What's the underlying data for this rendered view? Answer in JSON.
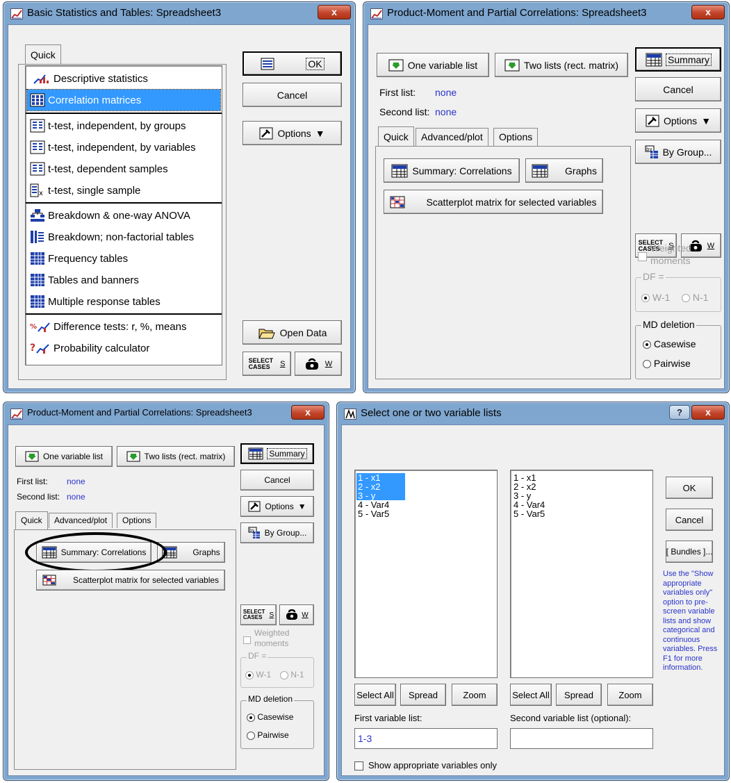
{
  "win1": {
    "title": "Basic Statistics and Tables: Spreadsheet3",
    "close": "x",
    "tab": "Quick",
    "items": [
      {
        "label": "Descriptive statistics",
        "icon": "descriptive-icon"
      },
      {
        "label": "Correlation matrices",
        "icon": "matrix-icon"
      },
      {
        "label": "t-test, independent, by groups",
        "icon": "ttest-icon"
      },
      {
        "label": "t-test, independent, by variables",
        "icon": "ttest-icon"
      },
      {
        "label": "t-test, dependent samples",
        "icon": "ttest-icon"
      },
      {
        "label": "t-test, single sample",
        "icon": "ttest-single-icon"
      },
      {
        "label": "Breakdown & one-way ANOVA",
        "icon": "breakdown-icon"
      },
      {
        "label": "Breakdown; non-factorial tables",
        "icon": "breakdown-tables-icon"
      },
      {
        "label": "Frequency tables",
        "icon": "table-icon"
      },
      {
        "label": "Tables and banners",
        "icon": "table-icon"
      },
      {
        "label": "Multiple response tables",
        "icon": "table-icon"
      },
      {
        "label": "Difference tests: r, %, means",
        "icon": "difference-icon"
      },
      {
        "label": "Probability calculator",
        "icon": "probability-icon"
      }
    ],
    "selected_item": "Correlation matrices",
    "ok": "OK",
    "cancel": "Cancel",
    "options": "Options",
    "open_data": "Open Data",
    "select_cases_1": "SELECT",
    "select_cases_2": "CASES",
    "s": "S",
    "w": "W"
  },
  "win2": {
    "title": "Product-Moment and Partial Correlations: Spreadsheet3",
    "close": "x",
    "one_var": "One variable list",
    "two_lists": "Two lists (rect. matrix)",
    "summary": "Summary",
    "cancel": "Cancel",
    "options": "Options",
    "by_group": "By Group...",
    "first_list_label": "First list:",
    "first_list_value": "none",
    "second_list_label": "Second list:",
    "second_list_value": "none",
    "tabs": [
      "Quick",
      "Advanced/plot",
      "Options"
    ],
    "summary_corr": "Summary: Correlations",
    "graphs": "Graphs",
    "scatterplot": "Scatterplot matrix for selected variables",
    "select_cases_1": "SELECT",
    "select_cases_2": "CASES",
    "s": "S",
    "w": "W",
    "weighted": "Weighted",
    "moments": "moments",
    "df": "DF =",
    "w1": "W-1",
    "n1": "N-1",
    "md_deletion": "MD deletion",
    "casewise": "Casewise",
    "pairwise": "Pairwise"
  },
  "win4": {
    "title": "Select one or two variable lists",
    "help": "?",
    "close": "x",
    "vars": [
      "1 - x1",
      "2 - x2",
      "3 - y",
      "4 - Var4",
      "5 - Var5"
    ],
    "selected_vars": [
      "1 - x1",
      "2 - x2",
      "3 - y"
    ],
    "ok": "OK",
    "cancel": "Cancel",
    "bundles": "[ Bundles ]...",
    "hint": "Use the \"Show appropriate variables only\" option to pre-screen variable lists and show categorical and continuous variables. Press F1 for more information.",
    "select_all": "Select All",
    "spread": "Spread",
    "zoom": "Zoom",
    "first_label": "First variable list:",
    "first_value": "1-3",
    "second_label": "Second variable list (optional):",
    "second_value": "",
    "show_appropriate": "Show appropriate variables only"
  }
}
